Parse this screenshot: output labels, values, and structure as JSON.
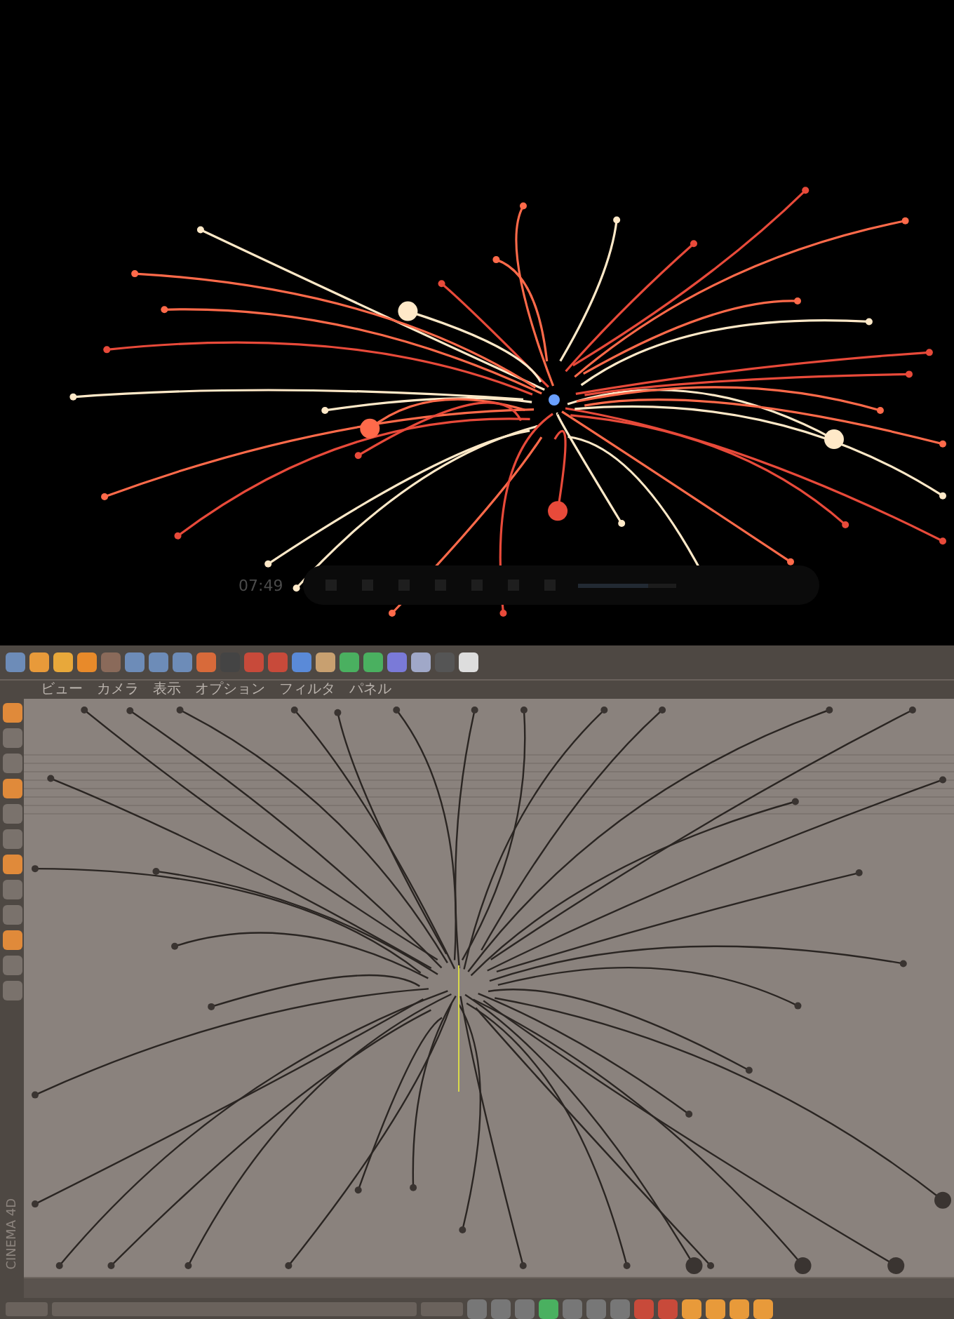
{
  "player": {
    "time": "07:49",
    "volume": {
      "level": 0.72
    }
  },
  "viewport": {
    "menu": [
      {
        "label": "ビュー"
      },
      {
        "label": "カメラ"
      },
      {
        "label": "表示"
      },
      {
        "label": "オプション"
      },
      {
        "label": "フィルタ"
      },
      {
        "label": "パネル"
      }
    ]
  },
  "logo": "CINEMA 4D"
}
